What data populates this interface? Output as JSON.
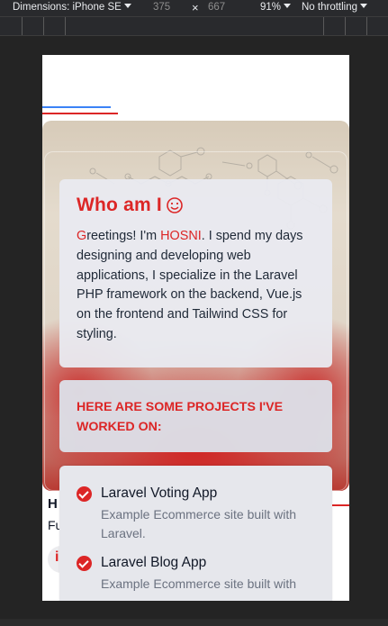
{
  "devtools": {
    "dimensions_label": "Dimensions: iPhone SE",
    "width": "375",
    "times": "×",
    "height": "667",
    "zoom": "91%",
    "throttling": "No throttling"
  },
  "about": {
    "title": "Who am I",
    "intro_first_letter": "G",
    "intro_a": "reetings! I'm ",
    "name": "HOSNI",
    "intro_b": ". I spend my days designing and developing web applications, I specialize in the Laravel PHP framework on the backend, Vue.js on the frontend and Tailwind CSS for styling."
  },
  "projects": {
    "heading": "HERE ARE SOME PROJECTS I'VE WORKED ON:",
    "items": [
      {
        "name": "Laravel Voting App",
        "description": "Example Ecommerce site built with Laravel."
      },
      {
        "name": "Laravel Blog App",
        "description": "Example Ecommerce site built with"
      }
    ]
  },
  "partial": {
    "heading_letter": "H",
    "sub_letters": "Fu",
    "pill_letter": "i"
  },
  "colors": {
    "accent_red": "#dc2626",
    "accent_blue": "#3b82f6"
  }
}
